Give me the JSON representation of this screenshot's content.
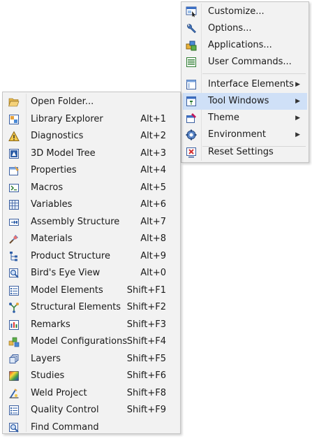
{
  "main_menu": {
    "items": [
      {
        "label": "Customize...",
        "icon": "customize-icon"
      },
      {
        "label": "Options...",
        "icon": "wrench-icon"
      },
      {
        "label": "Applications...",
        "icon": "applications-icon"
      },
      {
        "label": "User Commands...",
        "icon": "user-commands-icon"
      },
      {
        "label": "Interface Elements",
        "icon": "interface-elements-icon",
        "arrow": "▶"
      },
      {
        "label": "Tool Windows",
        "icon": "tool-windows-icon",
        "arrow": "▶"
      },
      {
        "label": "Theme",
        "icon": "theme-icon",
        "arrow": "▶"
      },
      {
        "label": "Environment",
        "icon": "environment-icon",
        "arrow": "▶"
      },
      {
        "label": "Reset Settings",
        "icon": "reset-settings-icon"
      }
    ]
  },
  "tool_windows_menu": {
    "items": [
      {
        "label": "Open Folder...",
        "shortcut": "",
        "icon": "folder-open-icon"
      },
      {
        "label": "Library Explorer",
        "shortcut": "Alt+1",
        "icon": "library-explorer-icon"
      },
      {
        "label": "Diagnostics",
        "shortcut": "Alt+2",
        "icon": "warning-icon"
      },
      {
        "label": "3D Model Tree",
        "shortcut": "Alt+3",
        "icon": "model-tree-icon"
      },
      {
        "label": "Properties",
        "shortcut": "Alt+4",
        "icon": "properties-icon"
      },
      {
        "label": "Macros",
        "shortcut": "Alt+5",
        "icon": "macros-icon"
      },
      {
        "label": "Variables",
        "shortcut": "Alt+6",
        "icon": "variables-icon"
      },
      {
        "label": "Assembly Structure",
        "shortcut": "Alt+7",
        "icon": "assembly-structure-icon"
      },
      {
        "label": "Materials",
        "shortcut": "Alt+8",
        "icon": "materials-icon"
      },
      {
        "label": "Product Structure",
        "shortcut": "Alt+9",
        "icon": "product-structure-icon"
      },
      {
        "label": "Bird's Eye View",
        "shortcut": "Alt+0",
        "icon": "birds-eye-view-icon"
      },
      {
        "label": "Model Elements",
        "shortcut": "Shift+F1",
        "icon": "model-elements-icon"
      },
      {
        "label": "Structural Elements",
        "shortcut": "Shift+F2",
        "icon": "structural-elements-icon"
      },
      {
        "label": "Remarks",
        "shortcut": "Shift+F3",
        "icon": "remarks-icon"
      },
      {
        "label": "Model Configurations",
        "shortcut": "Shift+F4",
        "icon": "model-configurations-icon"
      },
      {
        "label": "Layers",
        "shortcut": "Shift+F5",
        "icon": "layers-icon"
      },
      {
        "label": "Studies",
        "shortcut": "Shift+F6",
        "icon": "studies-icon"
      },
      {
        "label": "Weld Project",
        "shortcut": "Shift+F8",
        "icon": "weld-project-icon"
      },
      {
        "label": "Quality Control",
        "shortcut": "Shift+F9",
        "icon": "quality-control-icon"
      },
      {
        "label": "Find Command",
        "shortcut": "",
        "icon": "find-command-icon"
      }
    ]
  },
  "colors": {
    "menu_background": "#f2f2f2",
    "highlight": "#cfe0f7",
    "border": "#c4c4c4"
  }
}
